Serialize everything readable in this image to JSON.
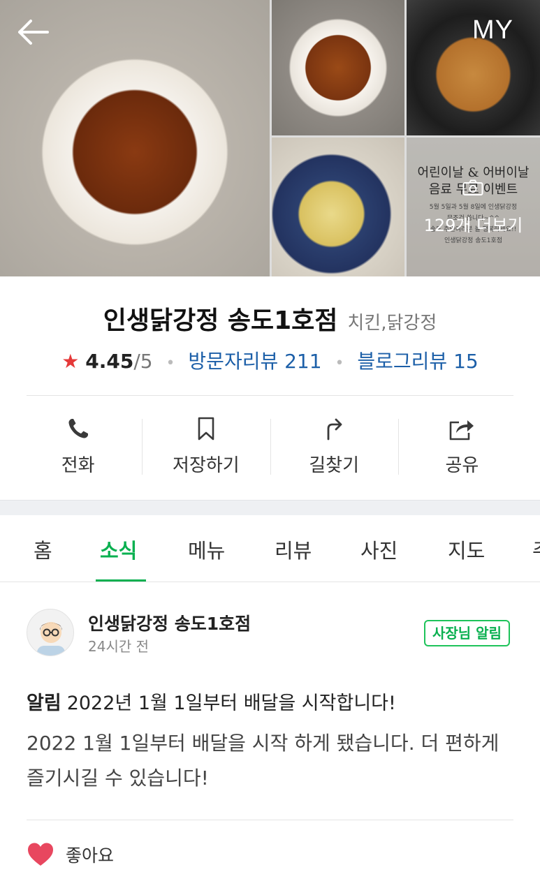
{
  "header": {
    "back_icon": "arrow-left-icon",
    "my_label": "MY"
  },
  "gallery": {
    "poster_line1": "어린이날 & 어버이날",
    "poster_line2": "음료 무료 이벤트",
    "poster_small": "5월 5일과 5월 8일에 인생닭강정\n무조건 쏩니다~^^\n송도 주민여러분 늘 행복하세요!!\n인생닭강정 송도1호점",
    "camera_icon": "camera-icon",
    "more_label": "129개 더보기"
  },
  "store": {
    "name": "인생닭강정 송도1호점",
    "category": "치킨,닭강정"
  },
  "rating": {
    "star_icon": "star-icon",
    "score": "4.45",
    "max": "/5",
    "visitor_reviews": "방문자리뷰 211",
    "blog_reviews": "블로그리뷰 15"
  },
  "actions": [
    {
      "icon": "phone-icon",
      "label": "전화"
    },
    {
      "icon": "bookmark-icon",
      "label": "저장하기"
    },
    {
      "icon": "directions-icon",
      "label": "길찾기"
    },
    {
      "icon": "share-icon",
      "label": "공유"
    }
  ],
  "tabs": [
    "홈",
    "소식",
    "메뉴",
    "리뷰",
    "사진",
    "지도",
    "주"
  ],
  "active_tab": "소식",
  "post": {
    "author": "인생닭강정 송도1호점",
    "time": "24시간 전",
    "badge": "사장님 알림",
    "tag": "알림",
    "headline": "2022년 1월 1일부터 배달을 시작합니다!",
    "body": "2022 1월 1일부터 배달을 시작 하게 됐습니다. 더 편하게 즐기시길 수 있습니다!",
    "like_icon": "heart-icon",
    "like_label": "좋아요"
  },
  "colors": {
    "accent_green": "#0ab050",
    "link_blue": "#1c5fa8",
    "star_red": "#e53939"
  }
}
